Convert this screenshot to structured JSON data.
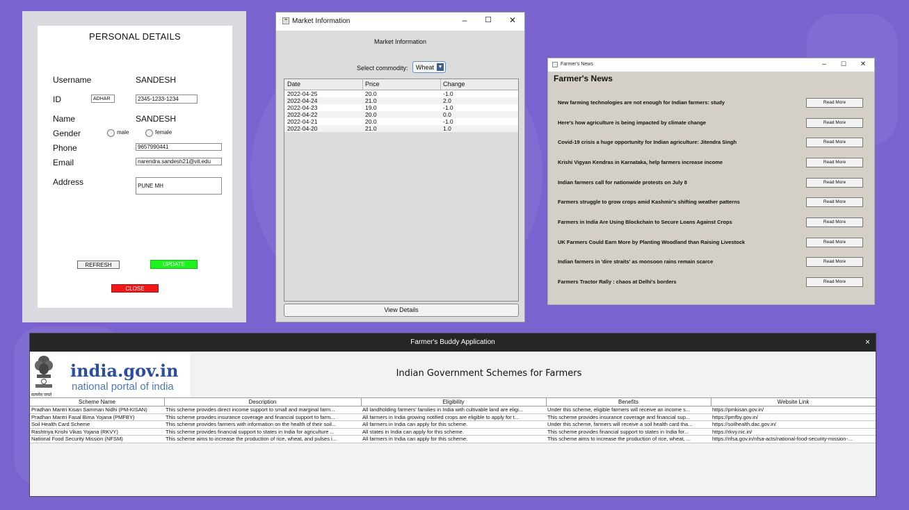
{
  "personal_details": {
    "title": "PERSONAL DETAILS",
    "username_label": "Username",
    "username_value": "SANDESH",
    "id_label": "ID",
    "id_type_value": "ADHAR",
    "id_value": "2345-1233-1234",
    "name_label": "Name",
    "name_value": "SANDESH",
    "gender_label": "Gender",
    "gender_male": "male",
    "gender_female": "female",
    "phone_label": "Phone",
    "phone_value": "9657990441",
    "email_label": "Email",
    "email_value": "narendra.sandesh21@vit.edu",
    "address_label": "Address",
    "address_value": "PUNE MH",
    "refresh_label": "REFRESH",
    "update_label": "UPDATE",
    "close_label": "CLOSE"
  },
  "market": {
    "window_title": "Market Information",
    "heading": "Market Information",
    "select_label": "Select commodity:",
    "selected_commodity": "Wheat",
    "columns": [
      "Date",
      "Price",
      "Change"
    ],
    "rows": [
      [
        "2022-04-25",
        "20.0",
        "-1.0"
      ],
      [
        "2022-04-24",
        "21.0",
        "2.0"
      ],
      [
        "2022-04-23",
        "19.0",
        "-1.0"
      ],
      [
        "2022-04-22",
        "20.0",
        "0.0"
      ],
      [
        "2022-04-21",
        "20.0",
        "-1.0"
      ],
      [
        "2022-04-20",
        "21.0",
        "1.0"
      ]
    ],
    "view_details_label": "View Details"
  },
  "news": {
    "window_title": "Farmer's News",
    "heading": "Farmer's News",
    "read_more_label": "Read More",
    "items": [
      "New farming technologies are not enough for Indian farmers: study",
      "Here's how agriculture is being impacted by climate change",
      "Covid-19 crisis a huge opportunity for Indian agriculture: Jitendra Singh",
      "Krishi Vigyan Kendras in Karnataka, help farmers increase income",
      "Indian farmers call for nationwide protests on July 8",
      "Farmers struggle to grow crops amid Kashmir's shifting weather patterns",
      "Farmers in India Are Using Blockchain to Secure Loans Against Crops",
      "UK Farmers Could Earn More by Planting Woodland than Raising Livestock",
      "Indian farmers in 'dire straits' as monsoon rains remain scarce",
      "Farmers Tractor Rally : chaos at Delhi's borders"
    ]
  },
  "buddy": {
    "window_title": "Farmer's Buddy Application",
    "close_glyph": "×",
    "logo_main": "india.gov.in",
    "logo_sub": "national portal of india",
    "logo_small": "सत्यमेव जयते",
    "heading": "Indian Government Schemes for Farmers",
    "columns": [
      "Scheme Name",
      "Description",
      "Eligibility",
      "Benefits",
      "Website Link"
    ],
    "rows": [
      [
        "Pradhan Mantri Kisan Samman Nidhi (PM-KISAN)",
        "This scheme provides direct income support to small and marginal farm...",
        "All landholding farmers' families in India with cultivable land are eligi...",
        "Under this scheme, eligible farmers will receive an income s...",
        "https://pmkisan.gov.in/"
      ],
      [
        "Pradhan Mantri Fasal Bima Yojana (PMFBY)",
        "This scheme provides insurance coverage and financial support to farm...",
        "All farmers in India growing notified crops are eligible to apply for t...",
        "This scheme provides insurance coverage and financial sup...",
        "https://pmfby.gov.in/"
      ],
      [
        "Soil Health Card Scheme",
        "This scheme provides farmers with information on the health of their soil...",
        "All farmers in India can apply for this scheme.",
        "Under this scheme, farmers will receive a soil health card tha...",
        "https://soilhealth.dac.gov.in/"
      ],
      [
        "Rashtriya Krishi Vikas Yojana (RKVY)",
        "This scheme provides financial support to states in India for agriculture ...",
        "All states in India can apply for this scheme.",
        "This scheme provides financial support to states in India for...",
        "https://rkvy.nic.in/"
      ],
      [
        "National Food Security Mission (NFSM)",
        "This scheme aims to increase the production of rice, wheat, and pulses i...",
        "All farmers in India can apply for this scheme.",
        "This scheme aims to increase the production of rice, wheat, ...",
        "https://nfsa.gov.in/nfsa-acts/national-food-security-mission-..."
      ]
    ]
  },
  "colors": {
    "desktop_bg": "#7a63cf",
    "update_button": "#1cf31c",
    "close_button": "#f01818",
    "logo_blue": "#2a4d9c"
  }
}
